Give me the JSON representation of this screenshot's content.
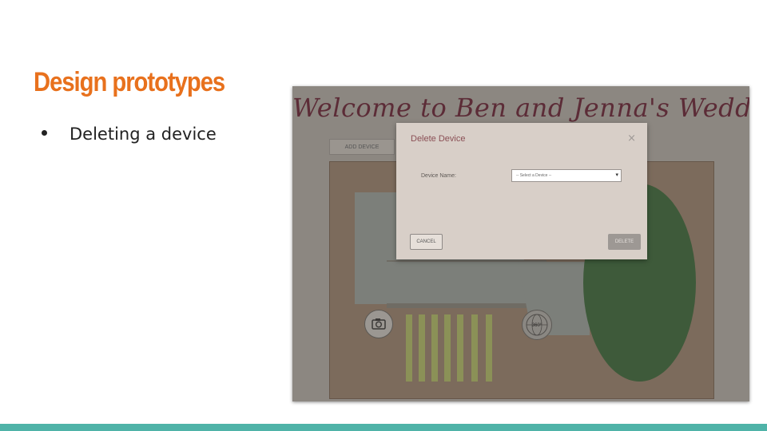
{
  "slide": {
    "title": "Design prototypes",
    "bullet": "Deleting a device"
  },
  "app": {
    "header_title": "Welcome to Ben and Jenna's Wedding",
    "add_device_label": "ADD DEVICE",
    "globe_label": "360°"
  },
  "dialog": {
    "title": "Delete Device",
    "close_glyph": "×",
    "field_label": "Device Name:",
    "select_value": "-- Select a Device --",
    "select_arrow": "▾",
    "cancel_label": "CANCEL",
    "delete_label": "DELETE"
  },
  "colors": {
    "title_accent": "#e8711d",
    "bottom_bar": "#4fb3a8",
    "header_text": "#5c2c37",
    "dialog_title": "#8a4f55"
  },
  "icons": [
    "camera-icon",
    "globe-360-icon",
    "close-icon",
    "chevron-down-icon"
  ]
}
